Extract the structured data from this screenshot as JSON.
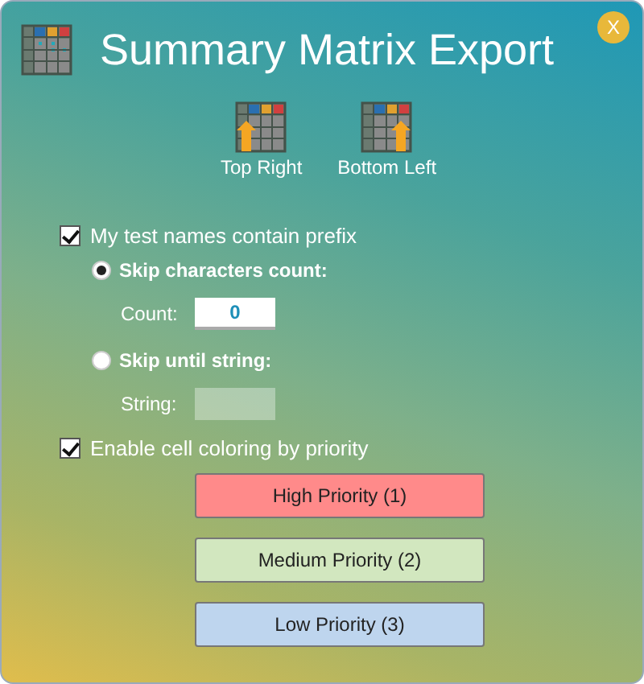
{
  "window": {
    "title": "Summary Matrix Export",
    "close": "X"
  },
  "positions": [
    {
      "label": "Top Right",
      "kind": "arrow-left"
    },
    {
      "label": "Bottom Left",
      "kind": "arrow-right"
    }
  ],
  "prefix": {
    "label": "My test names contain prefix",
    "checked": true
  },
  "modes": [
    {
      "label": "Skip characters count:",
      "selected": true,
      "field_label": "Count:",
      "value": "0"
    },
    {
      "label": "Skip until string:",
      "selected": false,
      "field_label": "String:"
    }
  ],
  "coloring": {
    "label": "Enable cell coloring by priority",
    "checked": true
  },
  "priorities": [
    {
      "label": "High Priority (1)",
      "color": "#ff8a8a"
    },
    {
      "label": "Medium Priority (2)",
      "color": "#d2e7bf"
    },
    {
      "label": "Low Priority (3)",
      "color": "#bed5ee"
    }
  ]
}
